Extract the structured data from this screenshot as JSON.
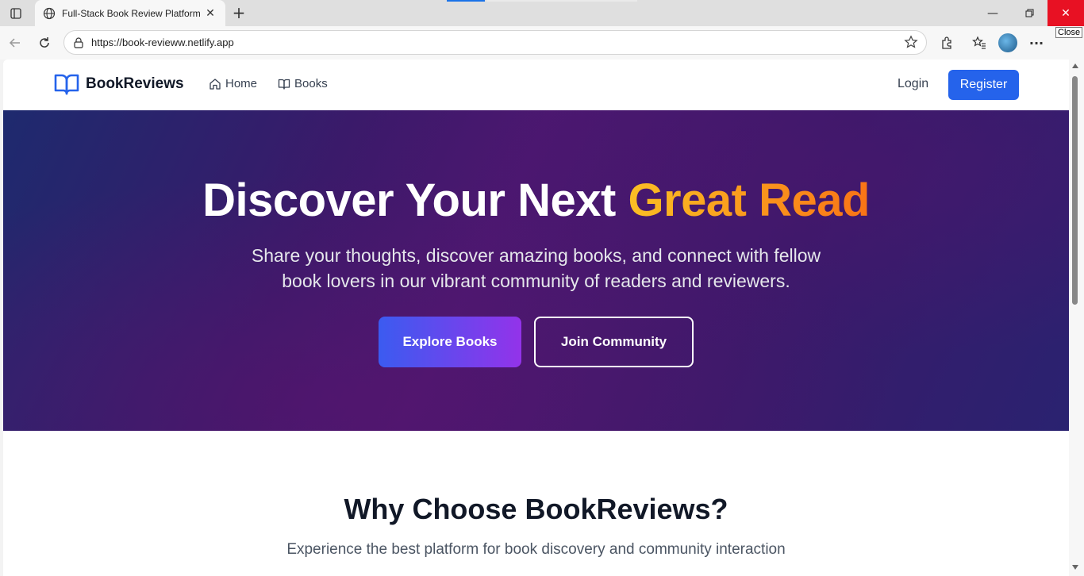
{
  "browser": {
    "tab_title": "Full-Stack Book Review Platform",
    "url": "https://book-revieww.netlify.app",
    "close_tooltip": "Close"
  },
  "site": {
    "brand": "BookReviews",
    "nav": {
      "home": "Home",
      "books": "Books",
      "login": "Login",
      "register": "Register"
    }
  },
  "hero": {
    "title_main": "Discover Your Next ",
    "title_accent": "Great Read",
    "subtitle_line1": "Share your thoughts, discover amazing books, and connect with fellow",
    "subtitle_line2": "book lovers in our vibrant community of readers and reviewers.",
    "explore_button": "Explore Books",
    "join_button": "Join Community"
  },
  "why": {
    "title": "Why Choose BookReviews?",
    "subtitle": "Experience the best platform for book discovery and community interaction"
  },
  "colors": {
    "primary": "#2563eb",
    "accent_start": "#fbbf24",
    "accent_end": "#f97316",
    "hero_bg": "#3a1a6a"
  },
  "icons": [
    "tab-list-icon",
    "globe-icon",
    "close-icon",
    "plus-icon",
    "minimize-icon",
    "restore-icon",
    "back-icon",
    "refresh-icon",
    "site-info-icon",
    "favorite-star-icon",
    "extensions-icon",
    "favorites-icon",
    "profile-avatar",
    "more-icon",
    "book-open-icon",
    "home-icon",
    "book-icon"
  ]
}
